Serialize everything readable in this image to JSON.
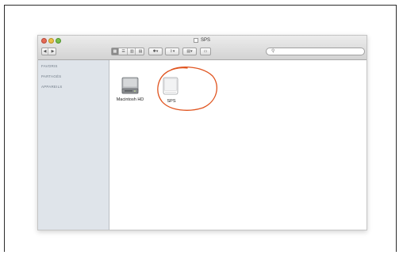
{
  "window": {
    "title": "SPS"
  },
  "toolbar": {
    "back_label": "◀",
    "forward_label": "▶",
    "view_modes": [
      "▦",
      "☰",
      "▥",
      "▤"
    ],
    "action_label": "✱▾",
    "share_label": "⇪▾",
    "arrange_label": "▤▾",
    "path_label": "▭"
  },
  "search": {
    "placeholder": "",
    "icon": "search-icon"
  },
  "sidebar": {
    "sections": [
      {
        "label": "FAVORIS"
      },
      {
        "label": "PARTAGÉS"
      },
      {
        "label": "APPAREILS"
      }
    ]
  },
  "content": {
    "items": [
      {
        "label": "Macintosh HD",
        "icon": "hard-drive-icon"
      },
      {
        "label": "SPS",
        "icon": "external-drive-icon",
        "highlighted": true
      }
    ]
  },
  "colors": {
    "annotation": "#e0541f",
    "sidebar_bg": "#dfe4ea",
    "close": "#e56b56",
    "minimize": "#e9bf46",
    "zoom": "#7ac04e"
  }
}
